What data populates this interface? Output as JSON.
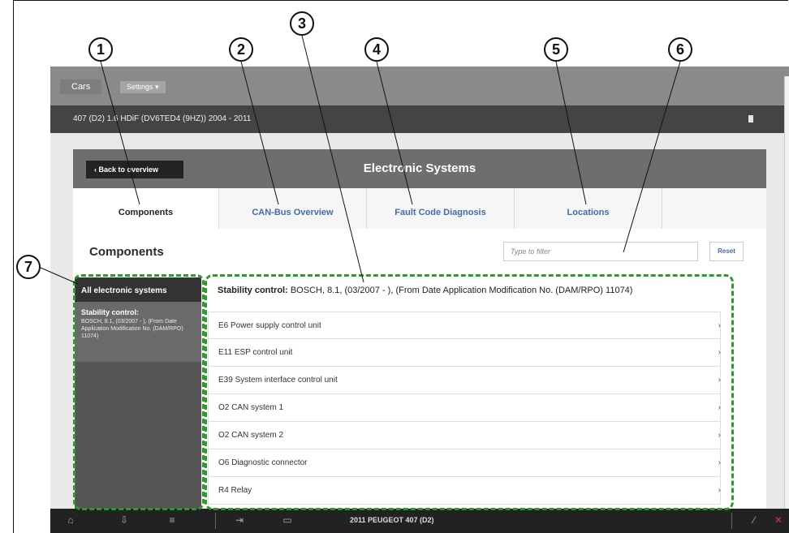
{
  "top_bar": {
    "cars_label": "Cars",
    "settings_label": "Settings ▾"
  },
  "vehicle_bar": {
    "title": "407 (D2) 1.6 HDiF (DV6TED4 (9HZ)) 2004 - 2011"
  },
  "header": {
    "back_label": "‹  Back to overview",
    "title": "Electronic Systems"
  },
  "tabs": [
    {
      "label": "Components"
    },
    {
      "label": "CAN-Bus Overview"
    },
    {
      "label": "Fault Code Diagnosis"
    },
    {
      "label": "Locations"
    }
  ],
  "components": {
    "title": "Components",
    "filter_placeholder": "Type to filter",
    "reset_label": "Reset"
  },
  "sidebar": {
    "all_label": "All electronic systems",
    "item": {
      "heading": "Stability control:",
      "description": "BOSCH, 8.1, (03/2007 - ), (From Date Application Modification No. (DAM/RPO) 11074)"
    }
  },
  "system_header": {
    "bold": "Stability control:",
    "rest": " BOSCH, 8.1, (03/2007 - ), (From Date Application Modification No. (DAM/RPO) 11074)"
  },
  "list_items": [
    "E6 Power supply control unit",
    "E11 ESP control unit",
    "E39 System interface control unit",
    "O2 CAN system 1",
    "O2 CAN system 2",
    "O6 Diagnostic connector",
    "R4 Relay"
  ],
  "bottom_bar": {
    "vehicle_label": "2011 PEUGEOT 407 (D2)"
  },
  "callouts": [
    "1",
    "2",
    "3",
    "4",
    "5",
    "6",
    "7"
  ],
  "colors": {
    "highlight_dash": "#2e9a2e",
    "link_blue": "#3f6ea8",
    "header_gray": "#6e6e6e"
  }
}
